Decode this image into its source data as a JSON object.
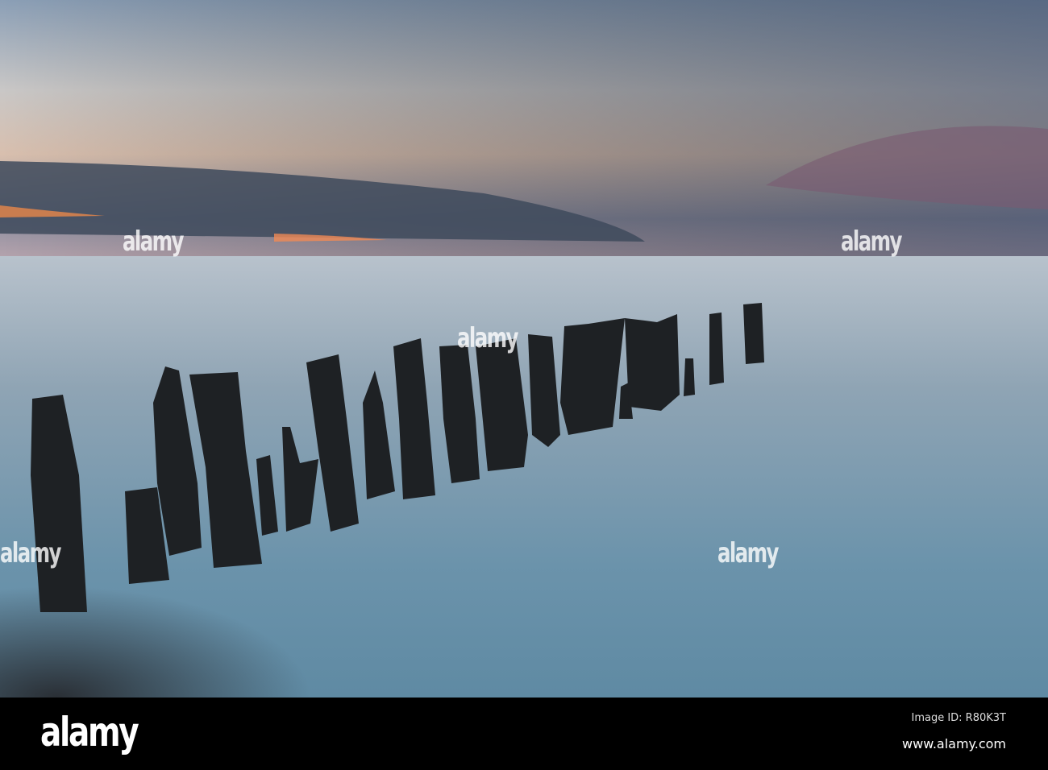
{
  "watermark": {
    "text": "alamy"
  },
  "footer": {
    "logo": "alamy",
    "image_id": "Image ID: R80K3T",
    "website": "www.alamy.com"
  }
}
